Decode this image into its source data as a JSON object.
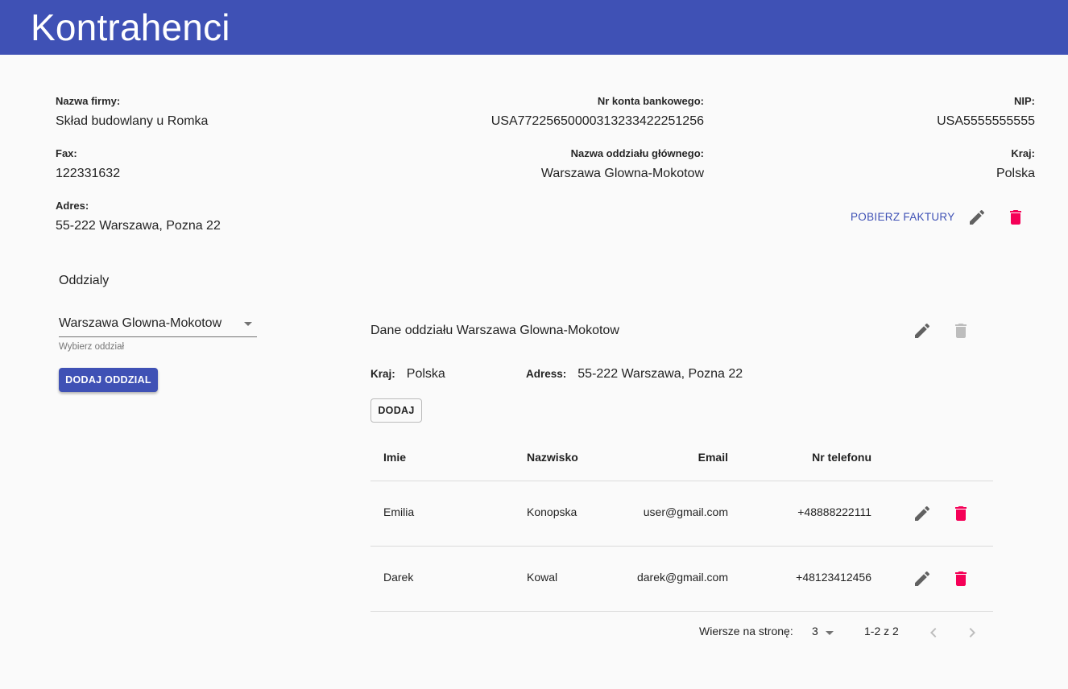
{
  "appbar": {
    "title": "Kontrahenci"
  },
  "company": {
    "name_label": "Nazwa firmy:",
    "name_value": "Skład budowlany u Romka",
    "account_label": "Nr konta bankowego:",
    "account_value": "USA77225650000313233422251256",
    "nip_label": "NIP:",
    "nip_value": "USA5555555555",
    "fax_label": "Fax:",
    "fax_value": "122331632",
    "branch_label": "Nazwa oddziału głównego:",
    "branch_value": "Warszawa Glowna-Mokotow",
    "country_label": "Kraj:",
    "country_value": "Polska",
    "address_label": "Adres:",
    "address_value": "55-222 Warszawa, Pozna 22",
    "download_invoices_label": "POBIERZ FAKTURY"
  },
  "branches": {
    "title": "Oddzialy",
    "select_value": "Warszawa Glowna-Mokotow",
    "select_helper": "Wybierz oddział",
    "add_branch_label": "DODAJ ODDZIAL"
  },
  "branch_details": {
    "title": "Dane oddziału Warszawa Glowna-Mokotow",
    "country_label": "Kraj:",
    "country_value": "Polska",
    "address_label": "Adress:",
    "address_value": "55-222 Warszawa, Pozna 22",
    "add_label": "DODAJ"
  },
  "table": {
    "headers": {
      "first_name": "Imie",
      "last_name": "Nazwisko",
      "email": "Email",
      "phone": "Nr telefonu"
    },
    "rows": [
      {
        "first_name": "Emilia",
        "last_name": "Konopska",
        "email": "user@gmail.com",
        "phone": "+48888222111"
      },
      {
        "first_name": "Darek",
        "last_name": "Kowal",
        "email": "darek@gmail.com",
        "phone": "+48123412456"
      }
    ]
  },
  "pagination": {
    "rows_per_page_label": "Wiersze na stronę:",
    "rows_per_page_value": "3",
    "range_label": "1-2 z 2"
  },
  "icons": {
    "edit": "pencil-icon",
    "delete": "trash-icon",
    "prev": "chevron-left-icon",
    "next": "chevron-right-icon",
    "dropdown": "caret-down-icon"
  },
  "colors": {
    "primary": "#3f51b5",
    "delete_active": "#f50057",
    "icon_grey": "#616161",
    "icon_disabled": "#bdbdbd"
  }
}
